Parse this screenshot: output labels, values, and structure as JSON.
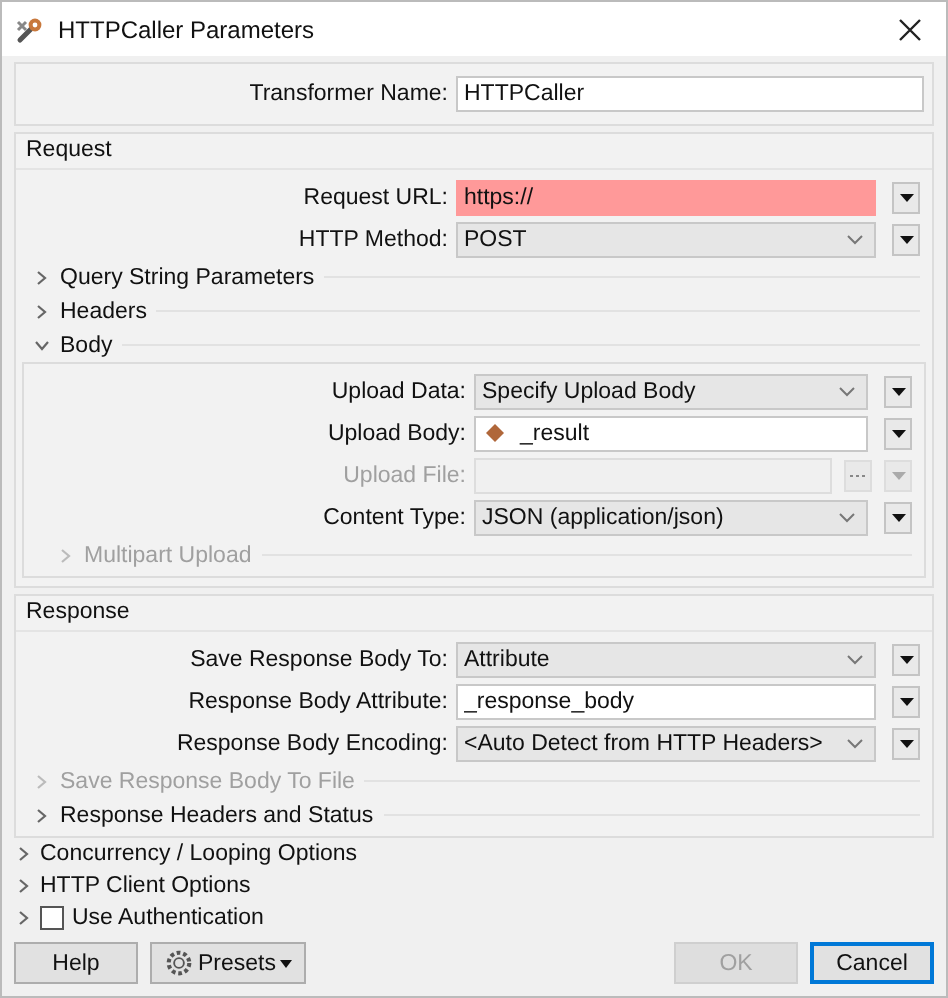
{
  "window": {
    "title": "HTTPCaller Parameters"
  },
  "transformer_name": {
    "label": "Transformer Name:",
    "value": "HTTPCaller"
  },
  "request": {
    "title": "Request",
    "fields": [
      {
        "label": "Request URL:",
        "value": "https://",
        "kind": "text",
        "invalid": true,
        "disabled": false
      },
      {
        "label": "HTTP Method:",
        "value": "POST",
        "kind": "select",
        "invalid": false,
        "disabled": false
      }
    ],
    "sections": [
      {
        "label": "Query String Parameters",
        "expanded": false,
        "disabled": false
      },
      {
        "label": "Headers",
        "expanded": false,
        "disabled": false
      },
      {
        "label": "Body",
        "expanded": true,
        "disabled": false,
        "fields": [
          {
            "label": "Upload Data:",
            "value": "Specify Upload Body",
            "kind": "select",
            "invalid": false,
            "disabled": false
          },
          {
            "label": "Upload Body:",
            "value": "_result",
            "kind": "attribute",
            "invalid": false,
            "disabled": false
          },
          {
            "label": "Upload File:",
            "kind": "file",
            "invalid": false,
            "disabled": true
          },
          {
            "label": "Content Type:",
            "value": "JSON (application/json)",
            "kind": "select",
            "invalid": false,
            "disabled": false
          }
        ],
        "sections": [
          {
            "label": "Multipart Upload",
            "expanded": false,
            "disabled": true
          }
        ]
      }
    ]
  },
  "response": {
    "title": "Response",
    "fields": [
      {
        "label": "Save Response Body To:",
        "value": "Attribute",
        "kind": "select",
        "invalid": false,
        "disabled": false
      },
      {
        "label": "Response Body Attribute:",
        "value": "_response_body",
        "kind": "text",
        "invalid": false,
        "disabled": false
      },
      {
        "label": "Response Body Encoding:",
        "value": "<Auto Detect from HTTP Headers>",
        "kind": "select",
        "invalid": false,
        "disabled": false
      }
    ],
    "sections": [
      {
        "label": "Save Response Body To File",
        "expanded": false,
        "disabled": true
      },
      {
        "label": "Response Headers and Status",
        "expanded": false,
        "disabled": false
      }
    ]
  },
  "options": [
    {
      "label": "Concurrency / Looping Options",
      "kind": "section",
      "expanded": false
    },
    {
      "label": "HTTP Client Options",
      "kind": "section",
      "expanded": false
    },
    {
      "label": "Use Authentication",
      "kind": "checkbox",
      "expanded": false,
      "checked": false
    }
  ],
  "buttons": {
    "left": [
      {
        "label": "Help",
        "kind": "plain",
        "disabled": false,
        "focused": false
      },
      {
        "label": "Presets",
        "kind": "menu",
        "disabled": false,
        "focused": false
      }
    ],
    "right": [
      {
        "label": "OK",
        "kind": "plain",
        "disabled": true,
        "focused": false
      },
      {
        "label": "Cancel",
        "kind": "plain",
        "disabled": false,
        "focused": true
      }
    ]
  }
}
